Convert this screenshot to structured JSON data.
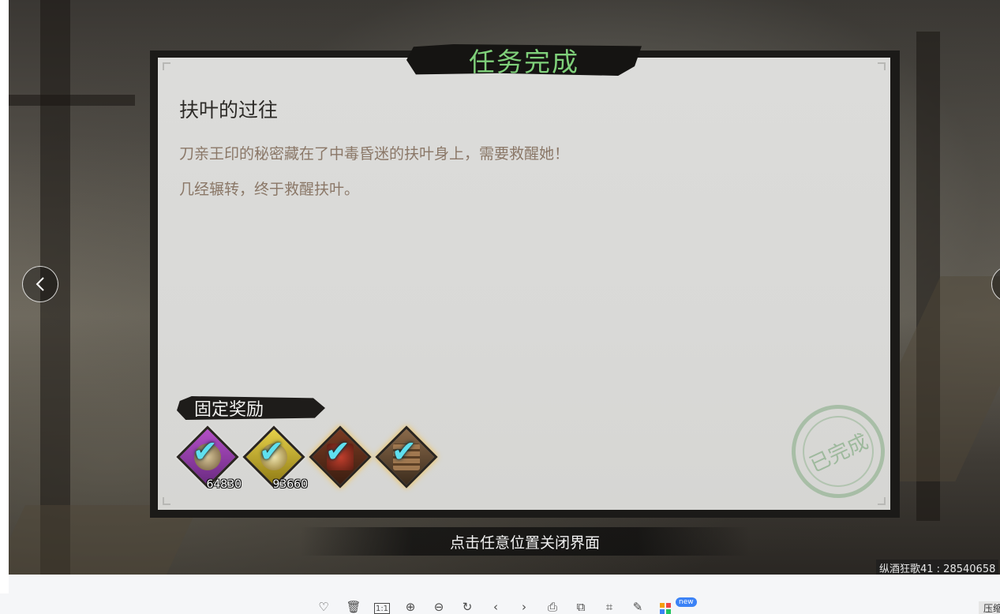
{
  "game": {
    "title": "任务完成",
    "quest_name": "扶叶的过往",
    "description_lines": [
      "刀亲王印的秘密藏在了中毒昏迷的扶叶身上，需要救醒她！",
      "几经辗转，终于救醒扶叶。"
    ],
    "reward_section_label": "固定奖励",
    "rewards": [
      {
        "icon": "purple-diamond-coin-icon",
        "count": "64830"
      },
      {
        "icon": "gold-diamond-coin-icon",
        "count": "93660"
      },
      {
        "icon": "treasure-chest-icon",
        "count": ""
      },
      {
        "icon": "wood-logs-icon",
        "count": ""
      }
    ],
    "stamp_text": "已完成",
    "close_hint": "点击任意位置关闭界面",
    "watermark": "纵酒狂歌41 : 28540658"
  },
  "viewer": {
    "prev_icon": "chevron-left-icon",
    "next_icon": "chevron-right-icon",
    "toolbar_icons": [
      "heart-icon",
      "trash-icon",
      "actual-size-icon",
      "zoom-in-icon",
      "zoom-out-icon",
      "rotate-icon",
      "previous-icon",
      "next-icon",
      "print-icon",
      "copy-icon",
      "crop-icon",
      "edit-icon",
      "apps-icon"
    ],
    "new_badge": "new",
    "compress_label": "压缩"
  },
  "colors": {
    "title_green": "#7fd07a",
    "desc_brown": "#8a7767",
    "check_cyan": "#5fe0ef"
  }
}
